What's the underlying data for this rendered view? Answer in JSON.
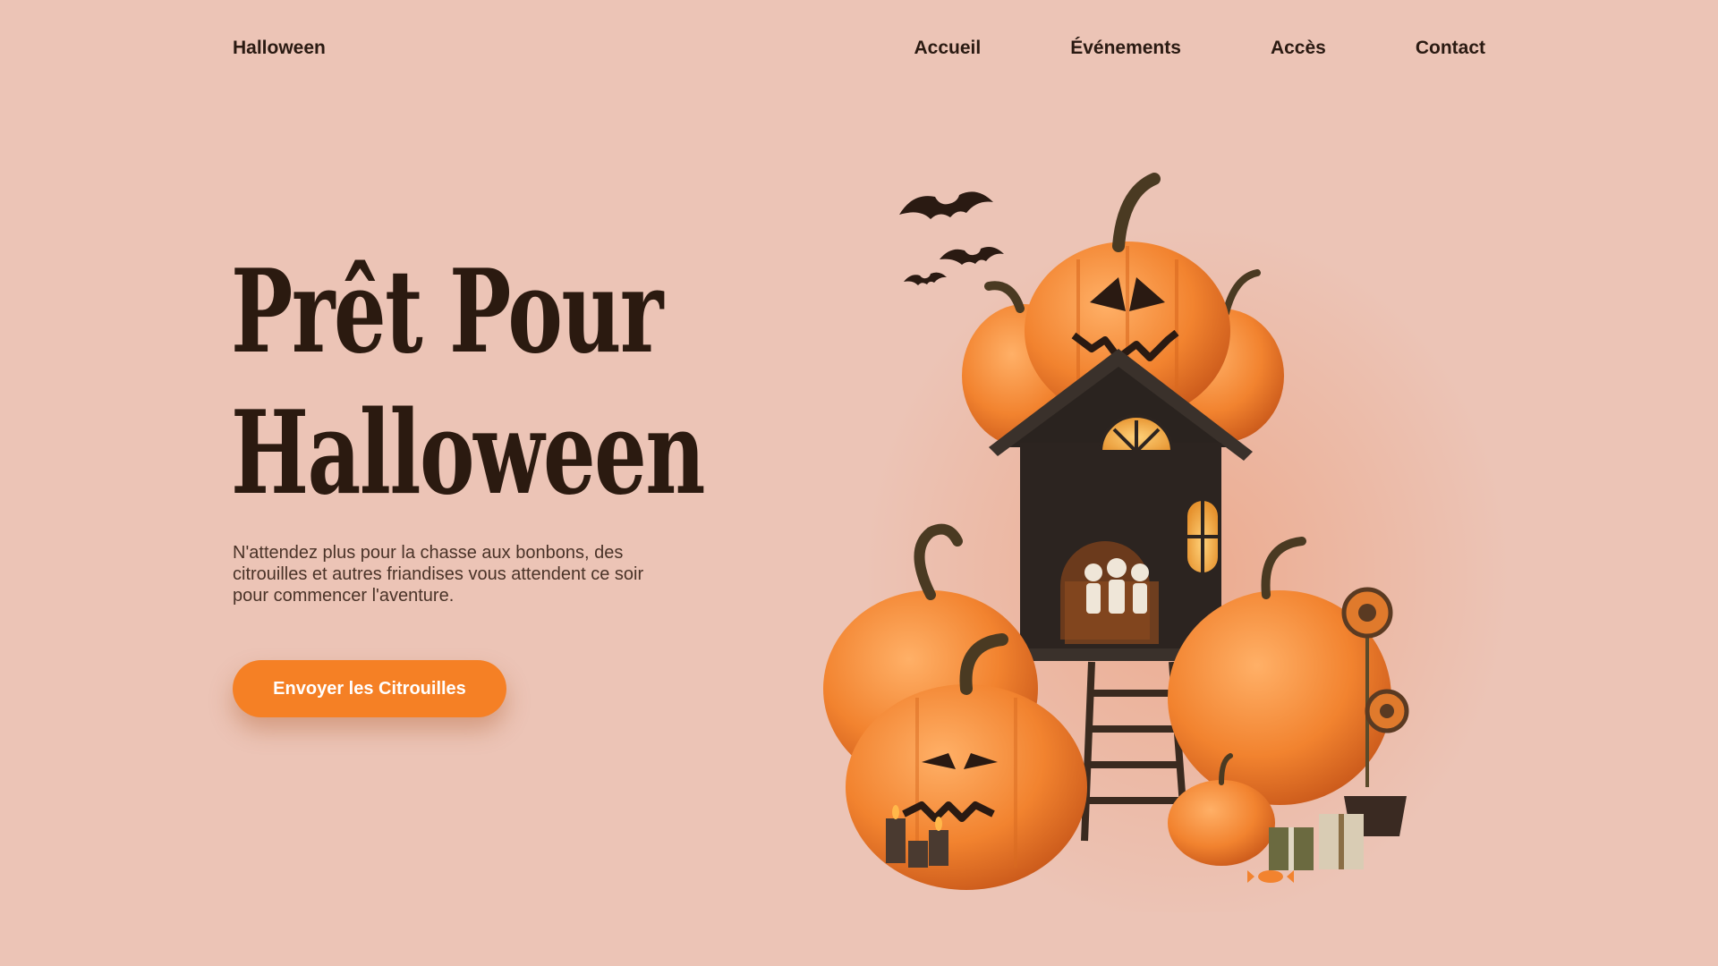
{
  "header": {
    "brand": "Halloween",
    "nav": [
      "Accueil",
      "Événements",
      "Accès",
      "Contact"
    ]
  },
  "hero": {
    "title_line1": "Prêt Pour",
    "title_line2": "Halloween",
    "description": "N'attendez plus pour la chasse aux bonbons, des citrouilles et autres friandises vous attendent ce soir pour commencer l'aventure.",
    "cta_label": "Envoyer les Citrouilles"
  },
  "colors": {
    "background": "#ecc4b6",
    "accent": "#f58025",
    "text": "#2a1a12"
  },
  "illustration": {
    "icons": [
      "bat-icon",
      "pumpkin-icon",
      "haunted-house-icon",
      "skeleton-icon",
      "candle-icon",
      "gift-box-icon",
      "lollipop-icon",
      "candy-icon"
    ]
  }
}
